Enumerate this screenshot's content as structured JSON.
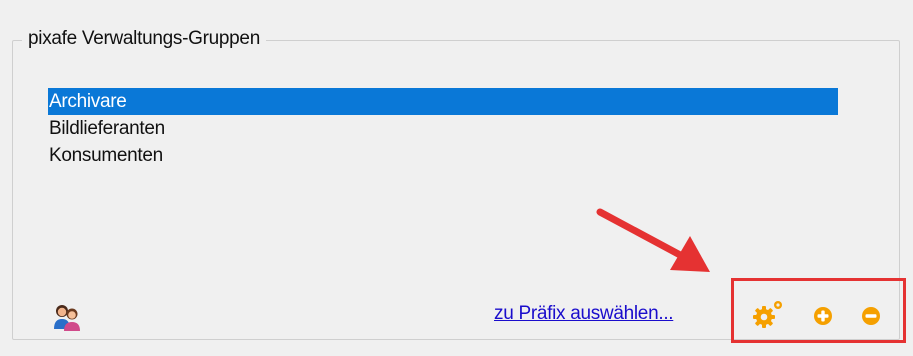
{
  "group": {
    "title": "pixafe Verwaltungs-Gruppen",
    "items": [
      {
        "label": "Archivare",
        "selected": true
      },
      {
        "label": "Bildlieferanten",
        "selected": false
      },
      {
        "label": "Konsumenten",
        "selected": false
      }
    ]
  },
  "footer": {
    "link_label": "zu Präfix auswählen...",
    "icons": {
      "people": "people-icon",
      "settings": "gear-icon",
      "add": "plus-circle-icon",
      "remove": "minus-circle-icon"
    }
  },
  "colors": {
    "selection": "#0a78d7",
    "link": "#1a0dcc",
    "action_icon": "#f5a000",
    "annotation": "#e53232"
  }
}
